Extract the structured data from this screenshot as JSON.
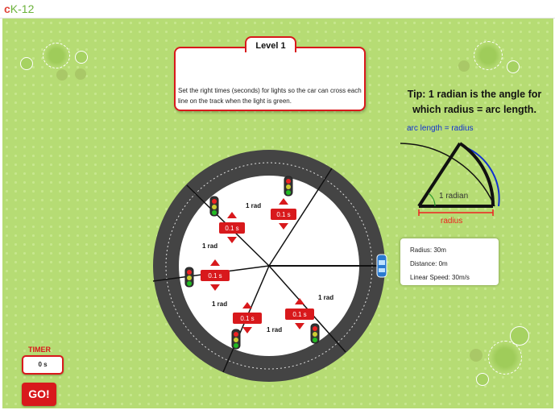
{
  "logo": {
    "part1": "c",
    "part2": "K-12"
  },
  "level": {
    "title": "Level 1",
    "instructions": "Set the right times (seconds) for lights so the car can cross each line on the track when the light is green."
  },
  "tip": {
    "text": "Tip: 1 radian is the angle for which radius = arc length.",
    "arc_label": "arc length = radius",
    "angle_label": "1 radian",
    "radius_label": "radius"
  },
  "track": {
    "angle_labels": [
      "1 rad",
      "1 rad",
      "1 rad",
      "1 rad",
      "1 rad"
    ],
    "timers": [
      "0.1 s",
      "0.1 s",
      "0.1 s",
      "0.1 s",
      "0.1 s"
    ]
  },
  "info": {
    "radius": "Radius: 30m",
    "distance": "Distance: 0m",
    "speed": "Linear Speed: 30m/s"
  },
  "timer": {
    "label": "TIMER",
    "value": "0 s"
  },
  "go_label": "GO!",
  "colors": {
    "accent_red": "#d8191c",
    "grass": "#b6dc74",
    "track": "#444444",
    "tip_blue": "#1030d0"
  }
}
